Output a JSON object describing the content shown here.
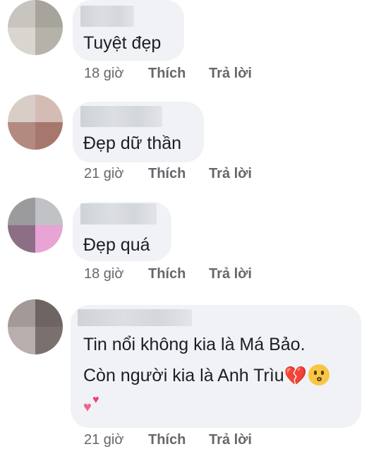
{
  "comments": [
    {
      "text_lines": [
        "Tuyệt đẹp"
      ],
      "time": "18 giờ",
      "like": "Thích",
      "reply": "Trả lời",
      "avatar_colors": [
        "#c8c5c0",
        "#a7a49c",
        "#d9d6cf",
        "#b5b2aa"
      ]
    },
    {
      "text_lines": [
        "Đẹp dữ thần"
      ],
      "time": "21 giờ",
      "like": "Thích",
      "reply": "Trả lời",
      "avatar_colors": [
        "#d9cdc8",
        "#d4bcb5",
        "#b38a7f",
        "#a7776e"
      ]
    },
    {
      "text_lines": [
        "Đẹp quá"
      ],
      "time": "18 giờ",
      "like": "Thích",
      "reply": "Trả lời",
      "avatar_colors": [
        "#9b9a9c",
        "#c0c2c6",
        "#8c6f87",
        "#e7a4d5"
      ]
    },
    {
      "text_lines": [
        "Tin nổi không kia là Má Bảo.",
        "Còn người kia là Anh Trìu"
      ],
      "emoji_line2": [
        "broken-heart-emoji",
        "kissing-face-emoji"
      ],
      "emoji_line3": [
        "two-hearts-emoji"
      ],
      "time": "21 giờ",
      "like": "Thích",
      "reply": "Trả lời",
      "avatar_colors": [
        "#a39a98",
        "#6e6562",
        "#b8aeab",
        "#7a706d"
      ]
    }
  ],
  "colors": {
    "bubble": "#f0f2f5",
    "meta_text": "#65676b",
    "body_text": "#1c1e21"
  }
}
